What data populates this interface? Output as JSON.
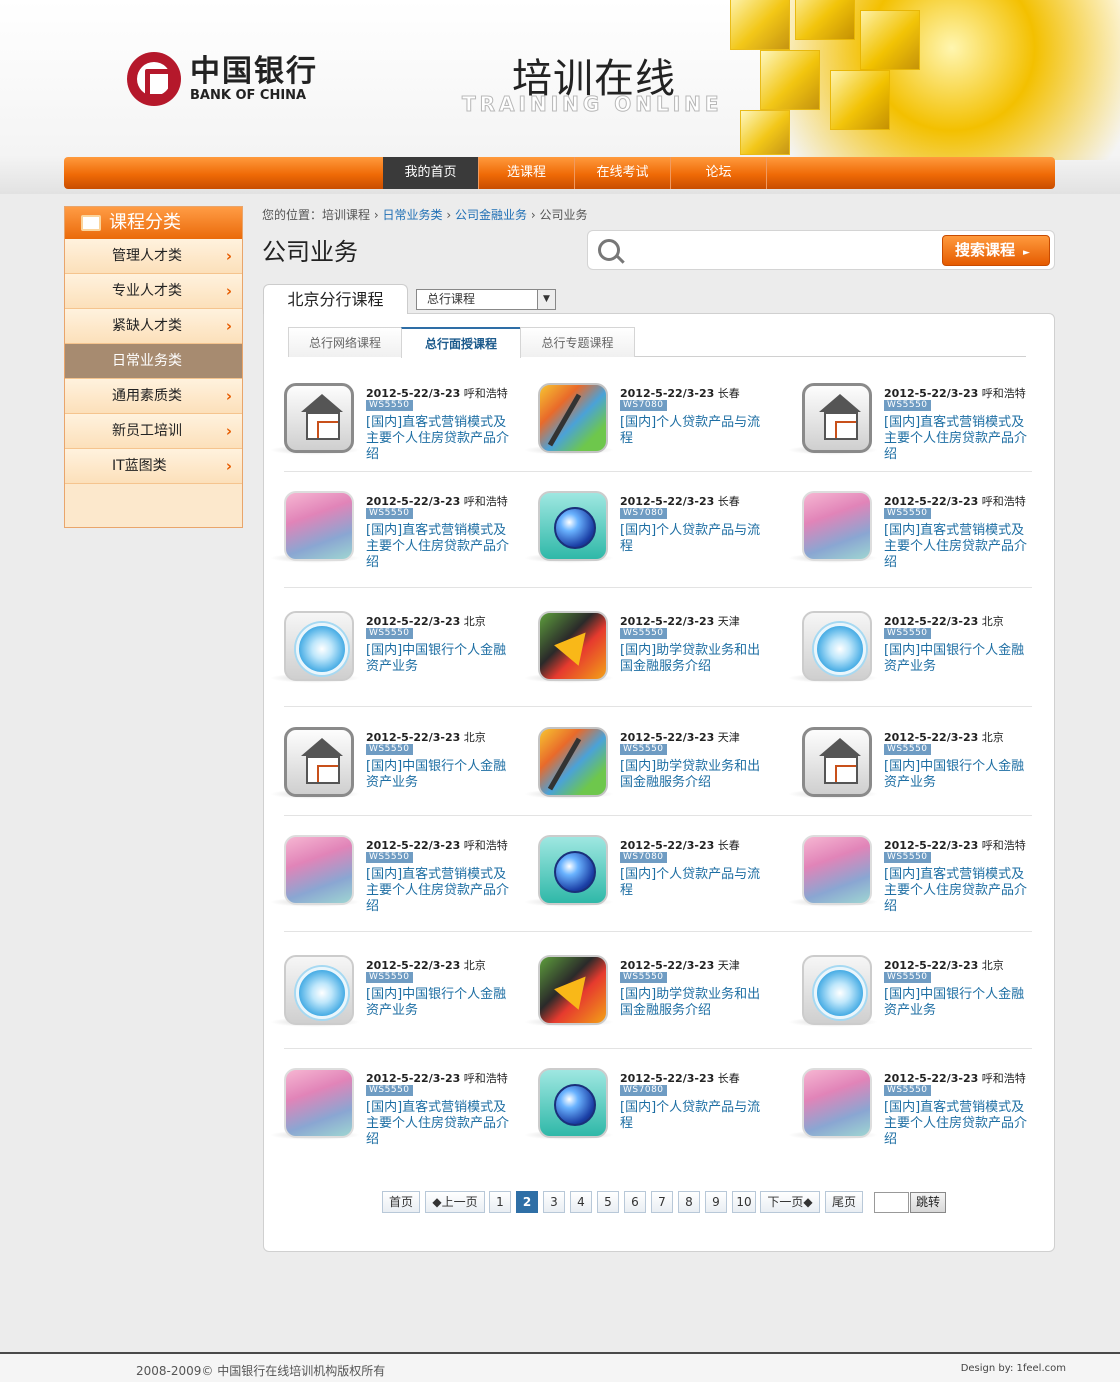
{
  "logo": {
    "cn": "中国银行",
    "en": "BANK OF CHINA"
  },
  "site": {
    "title": "培训在线",
    "subtitle": "TRAINING ONLINE"
  },
  "nav": {
    "items": [
      "我的首页",
      "选课程",
      "在线考试",
      "论坛"
    ],
    "active": 0
  },
  "sidebar": {
    "title": "课程分类",
    "items": [
      "管理人才类",
      "专业人才类",
      "紧缺人才类",
      "日常业务类",
      "通用素质类",
      "新员工培训",
      "IT蓝图类"
    ],
    "active": 3
  },
  "breadcrumb": {
    "prefix": "您的位置：",
    "items": [
      "培训课程",
      "日常业务类",
      "公司金融业务",
      "公司业务"
    ],
    "separator": "›"
  },
  "page_title": "公司业务",
  "search": {
    "placeholder": "",
    "button": "搜索课程"
  },
  "main_tab": "北京分行课程",
  "select": {
    "value": "总行课程"
  },
  "subtabs": {
    "items": [
      "总行网络课程",
      "总行面授课程",
      "总行专题课程"
    ],
    "active": 1
  },
  "courses": {
    "rows": [
      [
        {
          "icon": "house-icon",
          "date": "2012-5-22/3-23",
          "city": "呼和浩特",
          "code": "WS5550",
          "title": "[国内]直客式营销模式及主要个人住房贷款产品介绍"
        },
        {
          "icon": "books-icon",
          "date": "2012-5-22/3-23",
          "city": "长春",
          "code": "WS7080",
          "title": "[国内]个人贷款产品与流程"
        },
        {
          "icon": "house-icon",
          "date": "2012-5-22/3-23",
          "city": "呼和浩特",
          "code": "WS5550",
          "title": "[国内]直客式营销模式及主要个人住房贷款产品介绍"
        }
      ],
      [
        {
          "icon": "gradient-icon",
          "date": "2012-5-22/3-23",
          "city": "呼和浩特",
          "code": "WS5550",
          "title": "[国内]直客式营销模式及主要个人住房贷款产品介绍"
        },
        {
          "icon": "globe-icon",
          "date": "2012-5-22/3-23",
          "city": "长春",
          "code": "WS7080",
          "title": "[国内]个人贷款产品与流程"
        },
        {
          "icon": "gradient-icon",
          "date": "2012-5-22/3-23",
          "city": "呼和浩特",
          "code": "WS5550",
          "title": "[国内]直客式营销模式及主要个人住房贷款产品介绍"
        }
      ],
      [
        {
          "icon": "compass-icon",
          "date": "2012-5-22/3-23",
          "city": "北京",
          "code": "WS5550",
          "title": "[国内]中国银行个人金融资产业务"
        },
        {
          "icon": "arrows-icon",
          "date": "2012-5-22/3-23",
          "city": "天津",
          "code": "WS5550",
          "title": "[国内]助学贷款业务和出国金融服务介绍"
        },
        {
          "icon": "compass-icon",
          "date": "2012-5-22/3-23",
          "city": "北京",
          "code": "WS5550",
          "title": "[国内]中国银行个人金融资产业务"
        }
      ],
      [
        {
          "icon": "house-icon",
          "date": "2012-5-22/3-23",
          "city": "北京",
          "code": "WS5550",
          "title": "[国内]中国银行个人金融资产业务"
        },
        {
          "icon": "books-icon",
          "date": "2012-5-22/3-23",
          "city": "天津",
          "code": "WS5550",
          "title": "[国内]助学贷款业务和出国金融服务介绍"
        },
        {
          "icon": "house-icon",
          "date": "2012-5-22/3-23",
          "city": "北京",
          "code": "WS5550",
          "title": "[国内]中国银行个人金融资产业务"
        }
      ],
      [
        {
          "icon": "gradient-icon",
          "date": "2012-5-22/3-23",
          "city": "呼和浩特",
          "code": "WS5550",
          "title": "[国内]直客式营销模式及主要个人住房贷款产品介绍"
        },
        {
          "icon": "globe-icon",
          "date": "2012-5-22/3-23",
          "city": "长春",
          "code": "WS7080",
          "title": "[国内]个人贷款产品与流程"
        },
        {
          "icon": "gradient-icon",
          "date": "2012-5-22/3-23",
          "city": "呼和浩特",
          "code": "WS5550",
          "title": "[国内]直客式营销模式及主要个人住房贷款产品介绍"
        }
      ],
      [
        {
          "icon": "compass-icon",
          "date": "2012-5-22/3-23",
          "city": "北京",
          "code": "WS5550",
          "title": "[国内]中国银行个人金融资产业务"
        },
        {
          "icon": "arrows-icon",
          "date": "2012-5-22/3-23",
          "city": "天津",
          "code": "WS5550",
          "title": "[国内]助学贷款业务和出国金融服务介绍"
        },
        {
          "icon": "compass-icon",
          "date": "2012-5-22/3-23",
          "city": "北京",
          "code": "WS5550",
          "title": "[国内]中国银行个人金融资产业务"
        }
      ],
      [
        {
          "icon": "gradient-icon",
          "date": "2012-5-22/3-23",
          "city": "呼和浩特",
          "code": "WS5550",
          "title": "[国内]直客式营销模式及主要个人住房贷款产品介绍"
        },
        {
          "icon": "globe-icon",
          "date": "2012-5-22/3-23",
          "city": "长春",
          "code": "WS7080",
          "title": "[国内]个人贷款产品与流程"
        },
        {
          "icon": "gradient-icon",
          "date": "2012-5-22/3-23",
          "city": "呼和浩特",
          "code": "WS5550",
          "title": "[国内]直客式营销模式及主要个人住房贷款产品介绍"
        }
      ]
    ]
  },
  "pagination": {
    "first": "首页",
    "prev": "上一页",
    "pages": [
      "1",
      "2",
      "3",
      "4",
      "5",
      "6",
      "7",
      "8",
      "9",
      "10"
    ],
    "current": "2",
    "next": "下一页",
    "last": "尾页",
    "go": "跳转",
    "input_value": ""
  },
  "footer": {
    "copyright": "2008-2009© 中国银行在线培训机构版权所有",
    "design": "Design by: 1feel.com"
  },
  "colors": {
    "accent": "#ef6a06",
    "nav_active": "#3a3a3a",
    "sidebar_bg": "#fce8cc",
    "link": "#1d6ea3",
    "code_badge": "#6f9cc3",
    "pager_active": "#2f6fa6"
  }
}
